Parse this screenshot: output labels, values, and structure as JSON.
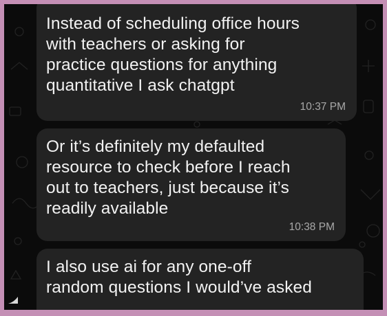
{
  "messages": [
    {
      "text": "Instead of scheduling office hours\nwith teachers or asking for\npractice questions for anything\nquantitative I ask chatgpt",
      "time": "10:37 PM"
    },
    {
      "text": "Or it’s definitely my defaulted\nresource to check before I reach\nout to teachers, just because it’s\nreadily available",
      "time": "10:38 PM"
    },
    {
      "text": "I also use ai for any one-off\nrandom questions I would’ve asked",
      "time": ""
    }
  ],
  "colors": {
    "border": "#c48fb5",
    "background": "#0b0b0b",
    "bubble": "#232323",
    "text": "#f2f2f2",
    "time": "#a9a9a9"
  },
  "icons": [
    "chat-wallpaper-doodles"
  ]
}
